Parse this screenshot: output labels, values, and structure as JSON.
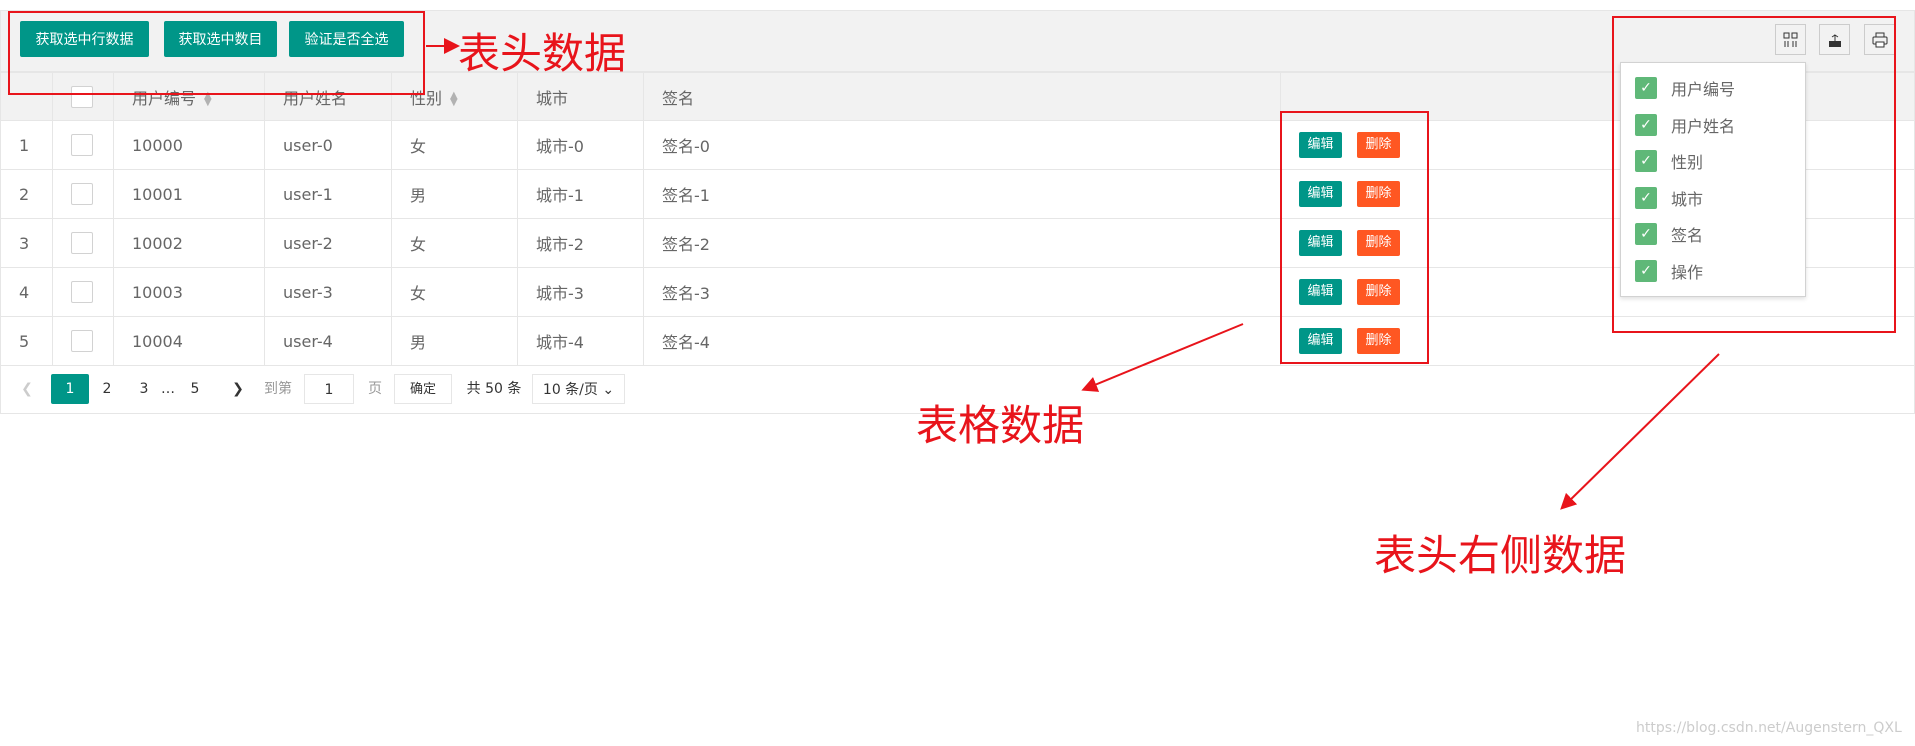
{
  "toolbar": {
    "buttons": [
      "获取选中行数据",
      "获取选中数目",
      "验证是否全选"
    ],
    "icons": [
      "columns-icon",
      "export-icon",
      "print-icon"
    ]
  },
  "table": {
    "headers": [
      "",
      "",
      "用户编号",
      "用户姓名",
      "性别",
      "城市",
      "签名",
      ""
    ],
    "rows": [
      {
        "index": "1",
        "id": "10000",
        "name": "user-0",
        "sex": "女",
        "city": "城市-0",
        "sign": "签名-0"
      },
      {
        "index": "2",
        "id": "10001",
        "name": "user-1",
        "sex": "男",
        "city": "城市-1",
        "sign": "签名-1"
      },
      {
        "index": "3",
        "id": "10002",
        "name": "user-2",
        "sex": "女",
        "city": "城市-2",
        "sign": "签名-2"
      },
      {
        "index": "4",
        "id": "10003",
        "name": "user-3",
        "sex": "女",
        "city": "城市-3",
        "sign": "签名-3"
      },
      {
        "index": "5",
        "id": "10004",
        "name": "user-4",
        "sex": "男",
        "city": "城市-4",
        "sign": "签名-4"
      }
    ],
    "edit_label": "编辑",
    "delete_label": "删除"
  },
  "pager": {
    "pages": [
      "1",
      "2",
      "3",
      "…",
      "5"
    ],
    "current": "1",
    "goto_label": "到第",
    "goto_value": "1",
    "page_label": "页",
    "confirm": "确定",
    "total": "共 50 条",
    "page_size": "10 条/页"
  },
  "columns_menu": [
    "用户编号",
    "用户姓名",
    "性别",
    "城市",
    "签名",
    "操作"
  ],
  "annotations": {
    "toolbar": "表头数据",
    "table": "表格数据",
    "right": "表头右侧数据"
  },
  "watermark": "https://blog.csdn.net/Augenstern_QXL",
  "colors": {
    "primary": "#009688",
    "danger": "#FF5722",
    "checked": "#5FB878",
    "annotation": "#e8141b"
  }
}
